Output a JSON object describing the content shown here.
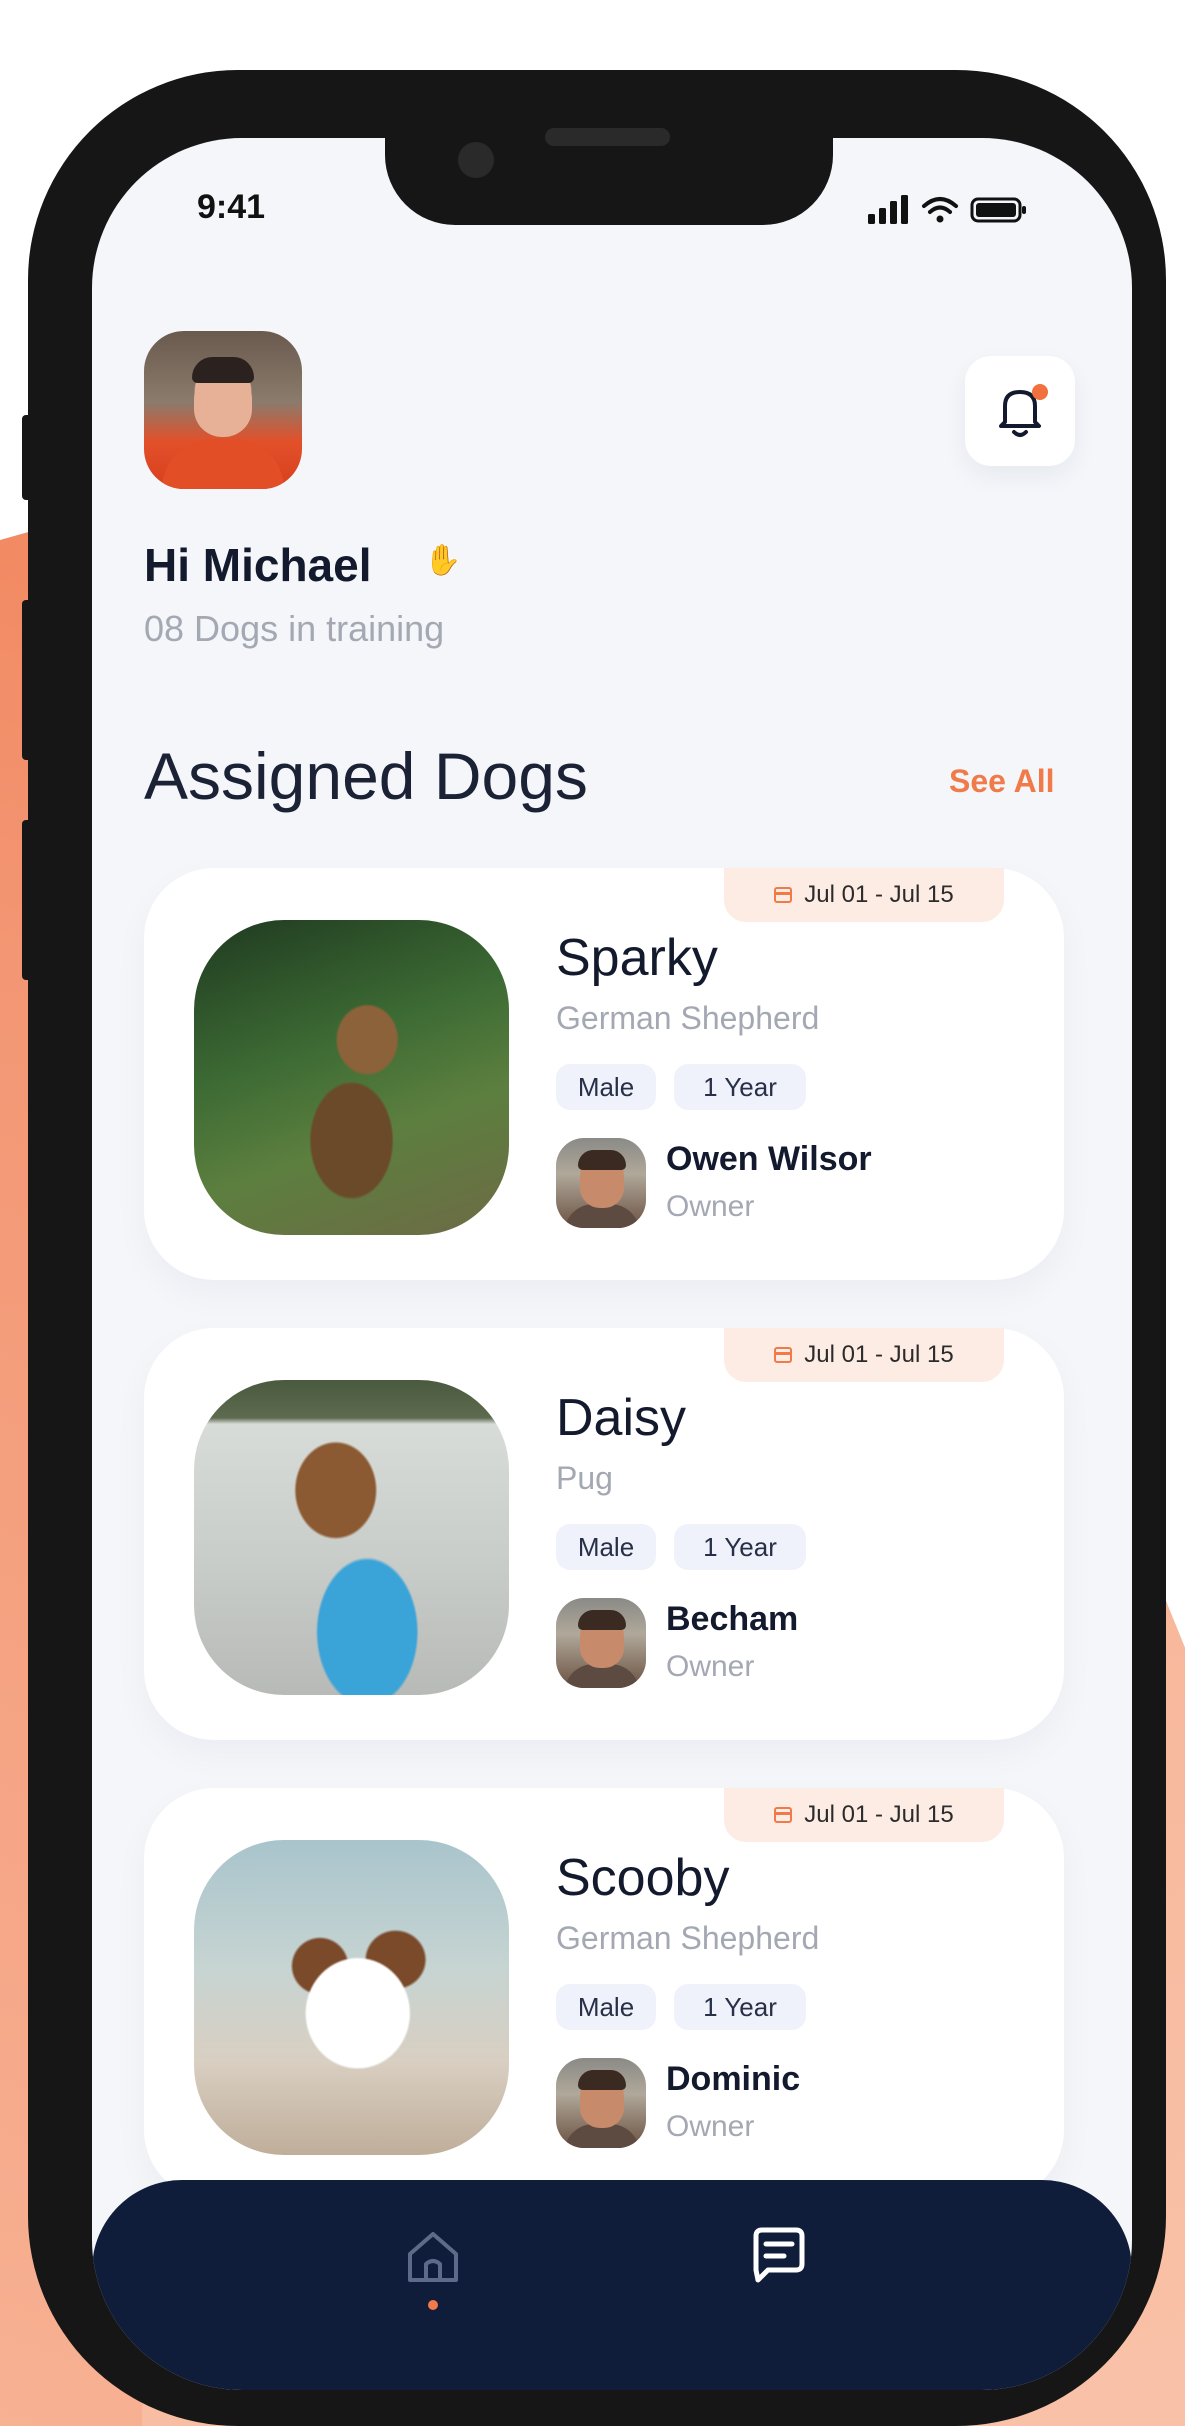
{
  "status_bar": {
    "time": "9:41"
  },
  "header": {
    "greeting": "Hi Michael",
    "subtitle": "08 Dogs in training"
  },
  "section": {
    "title": "Assigned Dogs",
    "see_all": "See All"
  },
  "dogs": [
    {
      "date_range": "Jul 01 - Jul 15",
      "name": "Sparky",
      "breed": "German Shepherd",
      "gender": "Male",
      "age": "1 Year",
      "owner_name": "Owen Wilsor",
      "owner_role": "Owner"
    },
    {
      "date_range": "Jul 01 - Jul 15",
      "name": "Daisy",
      "breed": "Pug",
      "gender": "Male",
      "age": "1 Year",
      "owner_name": "Becham",
      "owner_role": "Owner"
    },
    {
      "date_range": "Jul 01 - Jul 15",
      "name": "Scooby",
      "breed": "German Shepherd",
      "gender": "Male",
      "age": "1 Year",
      "owner_name": "Dominic",
      "owner_role": "Owner"
    }
  ],
  "nav": {
    "items": [
      {
        "icon": "home-icon",
        "active": true
      },
      {
        "icon": "chat-icon",
        "active": false
      }
    ]
  },
  "colors": {
    "accent": "#f07a48",
    "navy": "#0f1d3a",
    "background": "#f4f6fa"
  }
}
